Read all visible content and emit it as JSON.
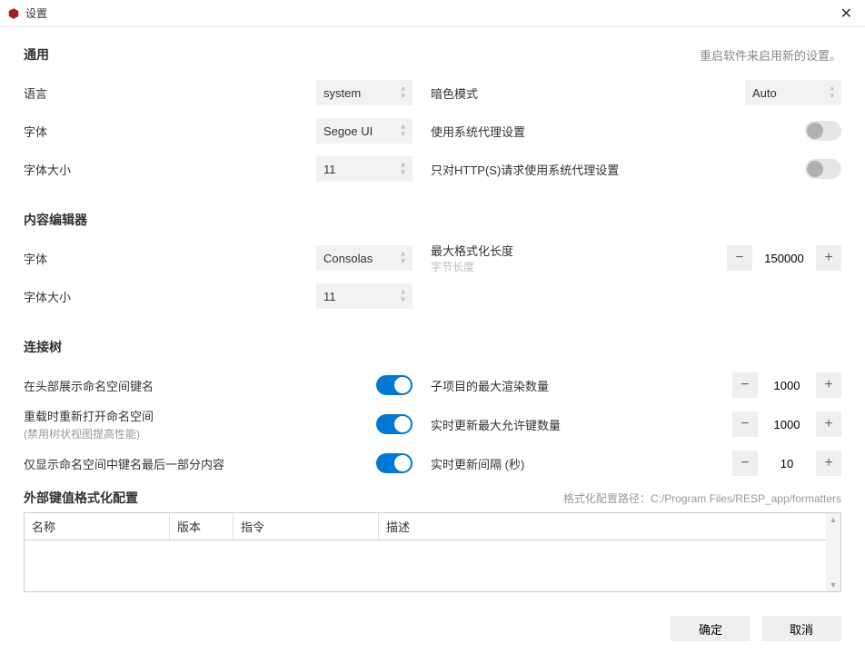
{
  "window": {
    "title": "设置"
  },
  "hint_restart": "重启软件来启用新的设置。",
  "sections": {
    "general": {
      "title": "通用",
      "language_label": "语言",
      "language_value": "system",
      "font_label": "字体",
      "font_value": "Segoe UI",
      "fontsize_label": "字体大小",
      "fontsize_value": "11",
      "darkmode_label": "暗色模式",
      "darkmode_value": "Auto",
      "use_system_proxy_label": "使用系统代理设置",
      "use_system_proxy_value": false,
      "http_proxy_label": "只对HTTP(S)请求使用系统代理设置",
      "http_proxy_value": false
    },
    "editor": {
      "title": "内容编辑器",
      "font_label": "字体",
      "font_value": "Consolas",
      "fontsize_label": "字体大小",
      "fontsize_value": "11",
      "maxformat_label": "最大格式化长度",
      "maxformat_hint": "字节长度",
      "maxformat_value": "150000"
    },
    "tree": {
      "title": "连接树",
      "show_ns_label": "在头部展示命名空间键名",
      "show_ns_value": true,
      "reopen_ns_label": "重载时重新打开命名空间",
      "reopen_ns_sub": "(禁用树状视图提高性能)",
      "reopen_ns_value": true,
      "short_ns_label": "仅显示命名空间中键名最后一部分内容",
      "short_ns_value": true,
      "maxrender_label": "子项目的最大渲染数量",
      "maxrender_value": "1000",
      "maxkeys_label": "实时更新最大允许键数量",
      "maxkeys_value": "1000",
      "interval_label": "实时更新间隔 (秒)",
      "interval_value": "10"
    },
    "formatters": {
      "title": "外部键值格式化配置",
      "path_label": "格式化配置路径：",
      "path_value": "C:/Program Files/RESP_app/formatters",
      "col_name": "名称",
      "col_version": "版本",
      "col_cmd": "指令",
      "col_desc": "描述"
    }
  },
  "buttons": {
    "ok": "确定",
    "cancel": "取消"
  }
}
